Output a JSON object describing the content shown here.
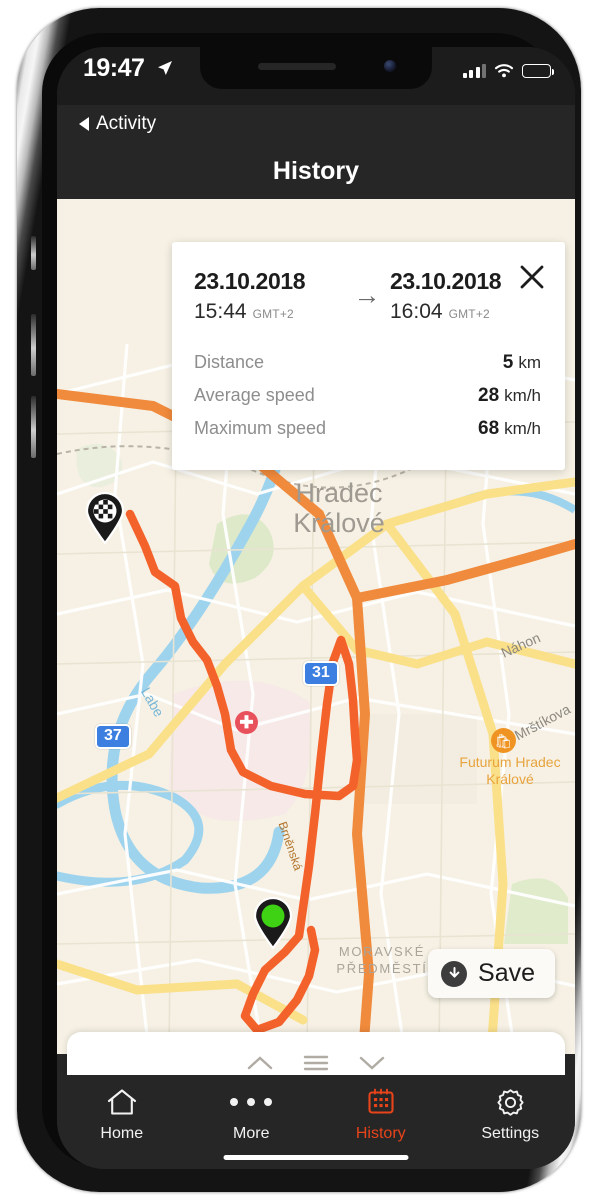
{
  "status_bar": {
    "time": "19:47",
    "location_arrow_icon": "location-arrow-icon",
    "signal_icon": "signal-icon",
    "wifi_icon": "wifi-icon",
    "battery_icon": "battery-icon"
  },
  "back_link": {
    "label": "Activity",
    "icon": "back-chevron-icon"
  },
  "header": {
    "title": "History"
  },
  "trip_card": {
    "start": {
      "date": "23.10.2018",
      "time": "15:44",
      "timezone": "GMT+2"
    },
    "end": {
      "date": "23.10.2018",
      "time": "16:04",
      "timezone": "GMT+2"
    },
    "arrow_icon": "arrow-right-icon",
    "close_icon": "close-icon",
    "stats": [
      {
        "label": "Distance",
        "value": "5",
        "unit": "km"
      },
      {
        "label": "Average speed",
        "value": "28",
        "unit": "km/h"
      },
      {
        "label": "Maximum speed",
        "value": "68",
        "unit": "km/h"
      }
    ]
  },
  "map": {
    "city_label": "Hradec\nKrálové",
    "district_label": "MORAVSKÉ\nPŘEDMĚSTÍ",
    "poi_label": "Futurum Hradec\nKrálové",
    "river_label": "Labe",
    "street_labels": [
      "Náhon",
      "Mrštíkova",
      "Brněnská"
    ],
    "road_shields": [
      "31",
      "37"
    ],
    "hospital_icon": "hospital-icon",
    "mall_icon": "shopping-bag-icon",
    "start_marker_icon": "start-pin-icon",
    "finish_marker_icon": "finish-flag-pin-icon",
    "route_color": "#f4622c",
    "background_color": "#f6f1e4"
  },
  "save_button": {
    "label": "Save",
    "icon": "download-circle-icon"
  },
  "bottom_sheet": {
    "controls": [
      {
        "name": "chevron-up-icon"
      },
      {
        "name": "hamburger-menu-icon"
      },
      {
        "name": "chevron-down-icon"
      }
    ]
  },
  "tab_bar": {
    "accent_color": "#e8441a",
    "items": [
      {
        "label": "Home",
        "icon": "home-icon",
        "active": false
      },
      {
        "label": "More",
        "icon": "ellipsis-icon",
        "active": false
      },
      {
        "label": "History",
        "icon": "calendar-icon",
        "active": true
      },
      {
        "label": "Settings",
        "icon": "gear-icon",
        "active": false
      }
    ]
  }
}
